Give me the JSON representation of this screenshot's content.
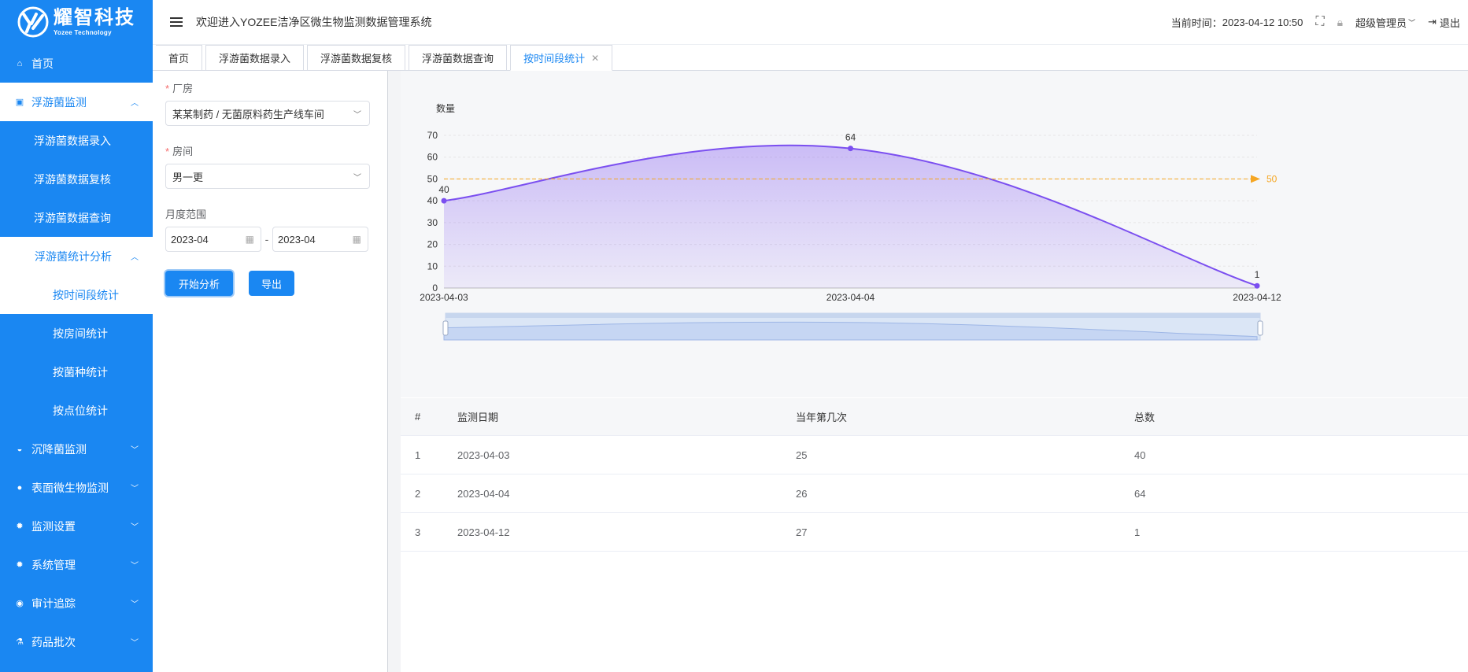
{
  "brand": {
    "name_cn": "耀智科技",
    "name_en": "Yozee Technology",
    "color": "#1a87f2"
  },
  "header": {
    "welcome": "欢迎进入YOZEE洁净区微生物监测数据管理系统",
    "time_label": "当前时间：",
    "time_value": "2023-04-12 10:50",
    "user": "超级管理员",
    "logout": "退出"
  },
  "sidebar": {
    "items": [
      {
        "label": "首页",
        "icon": "home-icon"
      },
      {
        "label": "浮游菌监测",
        "icon": "document-icon"
      },
      {
        "label": "浮游菌数据录入"
      },
      {
        "label": "浮游菌数据复核"
      },
      {
        "label": "浮游菌数据查询"
      },
      {
        "label": "浮游菌统计分析"
      },
      {
        "label": "按时间段统计"
      },
      {
        "label": "按房间统计"
      },
      {
        "label": "按菌种统计"
      },
      {
        "label": "按点位统计"
      },
      {
        "label": "沉降菌监测",
        "icon": "pie-icon"
      },
      {
        "label": "表面微生物监测",
        "icon": "circle-icon"
      },
      {
        "label": "监测设置",
        "icon": "gear-icon"
      },
      {
        "label": "系统管理",
        "icon": "gear-icon"
      },
      {
        "label": "审计追踪",
        "icon": "eye-icon"
      },
      {
        "label": "药品批次",
        "icon": "flask-icon"
      }
    ]
  },
  "tabs": [
    {
      "label": "首页"
    },
    {
      "label": "浮游菌数据录入"
    },
    {
      "label": "浮游菌数据复核"
    },
    {
      "label": "浮游菌数据查询"
    },
    {
      "label": "按时间段统计",
      "active": true
    }
  ],
  "form": {
    "plant_label": "厂房",
    "plant_value": "某某制药 / 无菌原料药生产线车间",
    "room_label": "房间",
    "room_value": "男一更",
    "range_label": "月度范围",
    "start": "2023-04",
    "end": "2023-04",
    "sep": "-",
    "analyze_btn": "开始分析",
    "export_btn": "导出"
  },
  "chart_data": {
    "type": "area",
    "ylabel": "数量",
    "x": [
      "2023-04-03",
      "2023-04-04",
      "2023-04-12"
    ],
    "values": [
      40,
      64,
      1
    ],
    "ylim": [
      0,
      70
    ],
    "yticks": [
      0,
      10,
      20,
      30,
      40,
      50,
      60,
      70
    ],
    "threshold": 50,
    "line_color": "#7b4ff0",
    "threshold_color": "#f5a623",
    "grid": true
  },
  "table": {
    "headers": [
      "#",
      "监测日期",
      "当年第几次",
      "总数"
    ],
    "rows": [
      [
        "1",
        "2023-04-03",
        "25",
        "40"
      ],
      [
        "2",
        "2023-04-04",
        "26",
        "64"
      ],
      [
        "3",
        "2023-04-12",
        "27",
        "1"
      ]
    ]
  }
}
